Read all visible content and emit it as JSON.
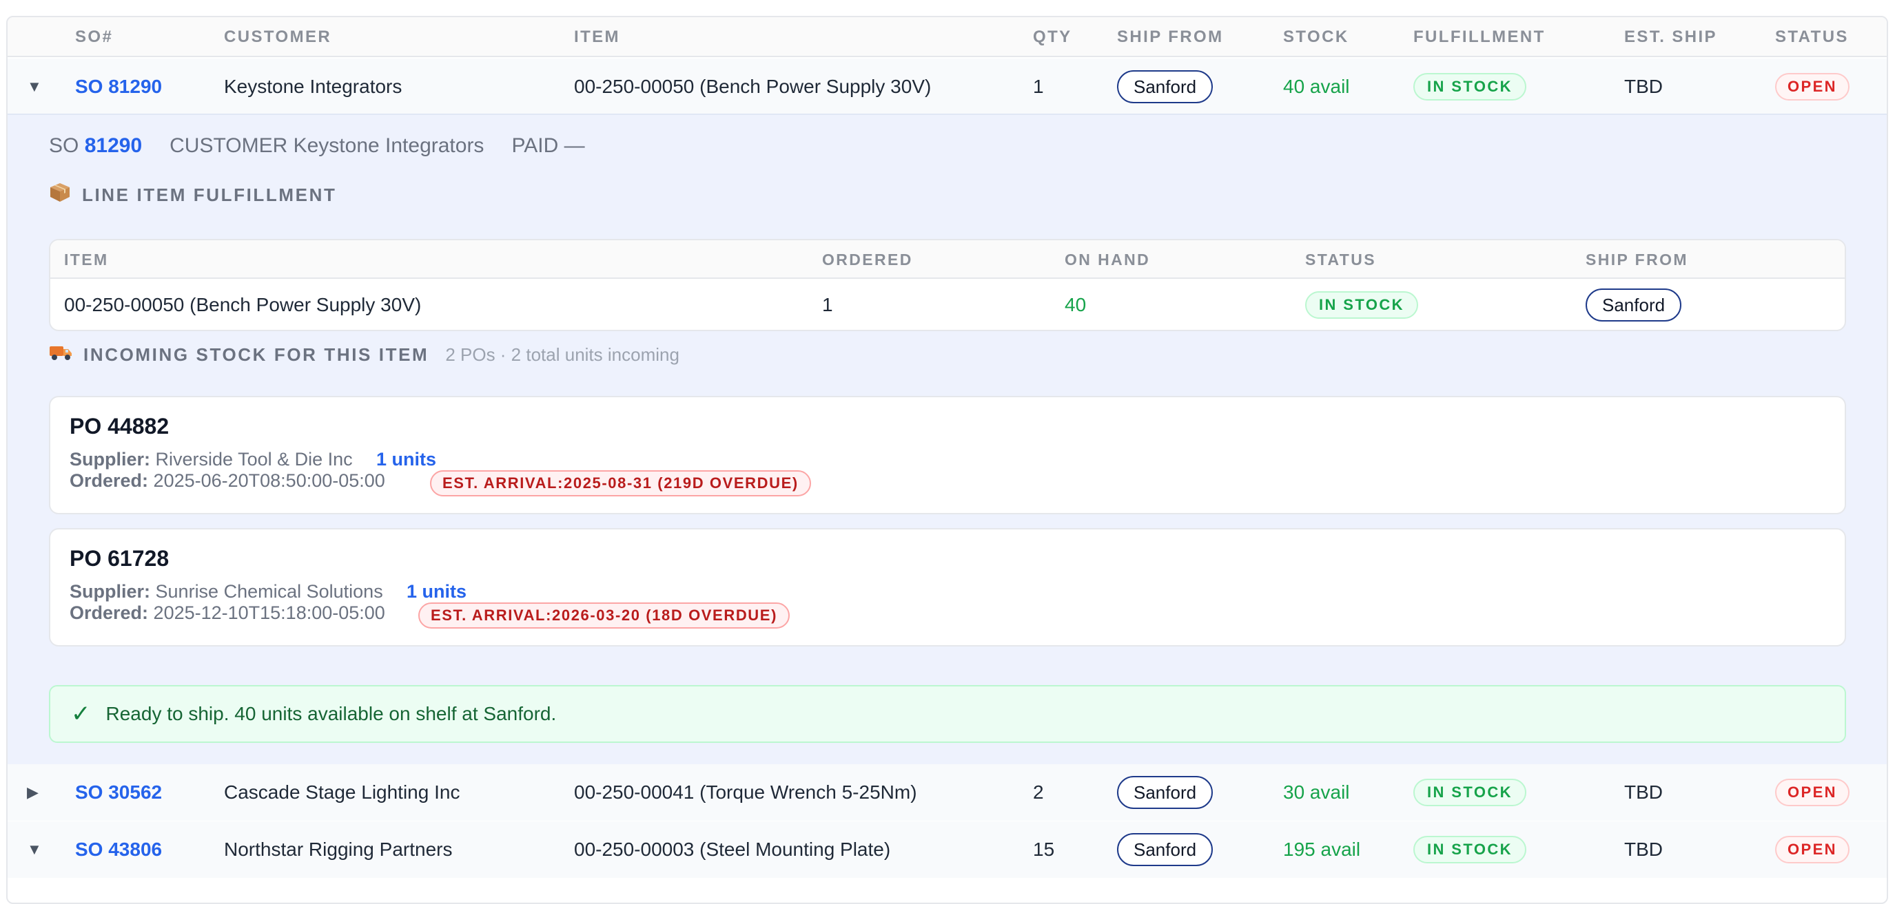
{
  "headers": {
    "so": "SO#",
    "customer": "CUSTOMER",
    "item": "ITEM",
    "qty": "QTY",
    "ship_from": "SHIP FROM",
    "stock": "STOCK",
    "fulfillment": "FULFILLMENT",
    "est_ship": "EST. SHIP",
    "status": "STATUS"
  },
  "rows": [
    {
      "chevron": "▼",
      "so": "SO 81290",
      "customer": "Keystone Integrators",
      "item": "00-250-00050 (Bench Power Supply 30V)",
      "qty": "1",
      "ship_from": "Sanford",
      "stock": "40 avail",
      "fulfillment": "IN STOCK",
      "est_ship": "TBD",
      "status": "OPEN"
    },
    {
      "chevron": "▶",
      "so": "SO 30562",
      "customer": "Cascade Stage Lighting Inc",
      "item": "00-250-00041 (Torque Wrench 5-25Nm)",
      "qty": "2",
      "ship_from": "Sanford",
      "stock": "30 avail",
      "fulfillment": "IN STOCK",
      "est_ship": "TBD",
      "status": "OPEN"
    },
    {
      "chevron": "▼",
      "so": "SO 43806",
      "customer": "Northstar Rigging Partners",
      "item": "00-250-00003 (Steel Mounting Plate)",
      "qty": "15",
      "ship_from": "Sanford",
      "stock": "195 avail",
      "fulfillment": "IN STOCK",
      "est_ship": "TBD",
      "status": "OPEN"
    }
  ],
  "detail": {
    "so_label": "SO",
    "so_number": "81290",
    "customer_label": "CUSTOMER",
    "customer": "Keystone Integrators",
    "paid_label": "PAID",
    "paid_value": "—",
    "line_section": {
      "icon": "package-icon",
      "title": "LINE ITEM FULFILLMENT",
      "headers": {
        "item": "ITEM",
        "ordered": "ORDERED",
        "on_hand": "ON HAND",
        "status": "STATUS",
        "ship_from": "SHIP FROM"
      },
      "row": {
        "item": "00-250-00050 (Bench Power Supply 30V)",
        "ordered": "1",
        "on_hand": "40",
        "status": "IN STOCK",
        "ship_from": "Sanford"
      }
    },
    "incoming_section": {
      "icon": "truck-icon",
      "title": "INCOMING STOCK FOR THIS ITEM",
      "summary": "2 POs · 2 total units incoming",
      "pos": [
        {
          "po": "PO 44882",
          "supplier_label": "Supplier:",
          "supplier": "Riverside Tool & Die Inc",
          "units": "1 units",
          "ordered_label": "Ordered:",
          "ordered": "2025-06-20T08:50:00-05:00",
          "arrival_label": "EST. ARRIVAL:",
          "arrival": "2025-08-31 (219D OVERDUE)"
        },
        {
          "po": "PO 61728",
          "supplier_label": "Supplier:",
          "supplier": "Sunrise Chemical Solutions",
          "units": "1 units",
          "ordered_label": "Ordered:",
          "ordered": "2025-12-10T15:18:00-05:00",
          "arrival_label": "EST. ARRIVAL:",
          "arrival": "2026-03-20 (18D OVERDUE)"
        }
      ]
    },
    "ready_icon": "checkmark-icon",
    "ready_message": "Ready to ship. 40 units available on shelf at Sanford."
  },
  "colors": {
    "link": "#2563eb",
    "in_stock": "#16a34a",
    "open_status": "#dc2626",
    "panel_bg": "#eef2fd",
    "ready_bg": "#ecfdf3"
  }
}
